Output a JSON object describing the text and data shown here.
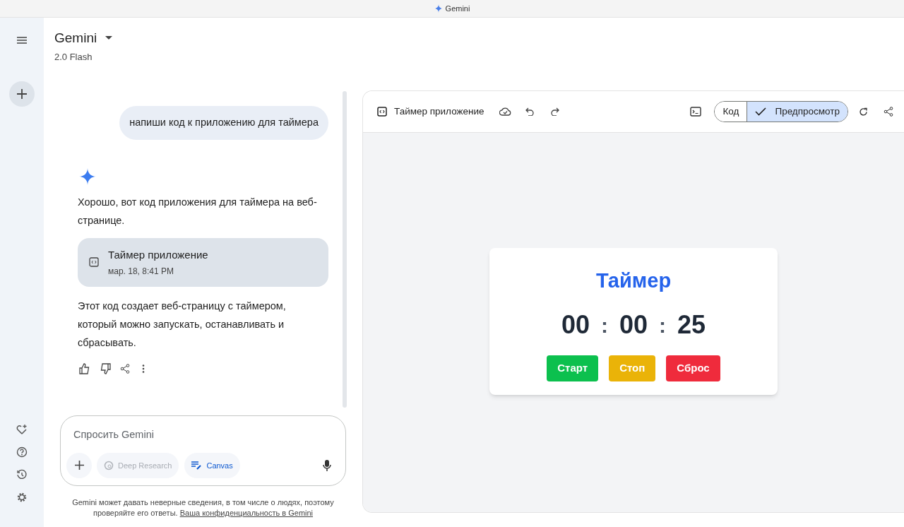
{
  "window": {
    "title": "Gemini"
  },
  "header": {
    "title": "Gemini",
    "model": "2.0 Flash"
  },
  "chat": {
    "user_message": "напиши код к приложению для таймера",
    "reply_intro": "Хорошо, вот код приложения для таймера на веб-странице.",
    "artifact": {
      "title": "Таймер приложение",
      "date": "мар. 18, 8:41 PM"
    },
    "reply_outro": "Этот код создает веб-страницу с таймером, который можно запускать, останавливать и сбрасывать."
  },
  "input": {
    "placeholder": "Спросить Gemini",
    "tools": [
      {
        "label": "Deep Research",
        "disabled": true
      },
      {
        "label": "Canvas",
        "disabled": false
      }
    ]
  },
  "disclaimer": {
    "text": "Gemini может давать неверные сведения, в том числе о людях, поэтому проверяйте его ответы.",
    "link": "Ваша конфиденциальность в Gemini"
  },
  "canvas": {
    "title": "Таймер приложение",
    "view_toggle": [
      {
        "label": "Код",
        "selected": false
      },
      {
        "label": "Предпросмотр",
        "selected": true
      }
    ],
    "preview": {
      "heading": "Таймер",
      "time": [
        "00",
        "00",
        "25"
      ],
      "separator": ":",
      "buttons": [
        {
          "label": "Старт",
          "color": "#0cc04e"
        },
        {
          "label": "Стоп",
          "color": "#eab308"
        },
        {
          "label": "Сброс",
          "color": "#ef2b3c"
        }
      ]
    }
  }
}
